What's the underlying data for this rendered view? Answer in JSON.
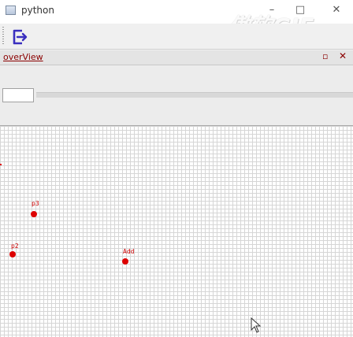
{
  "window": {
    "title": "python",
    "watermark": "傲软GIF"
  },
  "window_buttons": {
    "minimize": "–",
    "maximize": "□",
    "close": "✕"
  },
  "toolbar": {
    "exit_icon": "exit-door-icon"
  },
  "dock": {
    "title": "overView",
    "float_glyph": "▫",
    "close_glyph": "✕"
  },
  "canvas": {
    "points": [
      {
        "label": "p3"
      },
      {
        "label": "p2"
      },
      {
        "label": "Add"
      }
    ]
  },
  "colors": {
    "accent": "#dd0000",
    "dock_title": "#8b0000",
    "icon_blue": "#3a2fbf"
  }
}
